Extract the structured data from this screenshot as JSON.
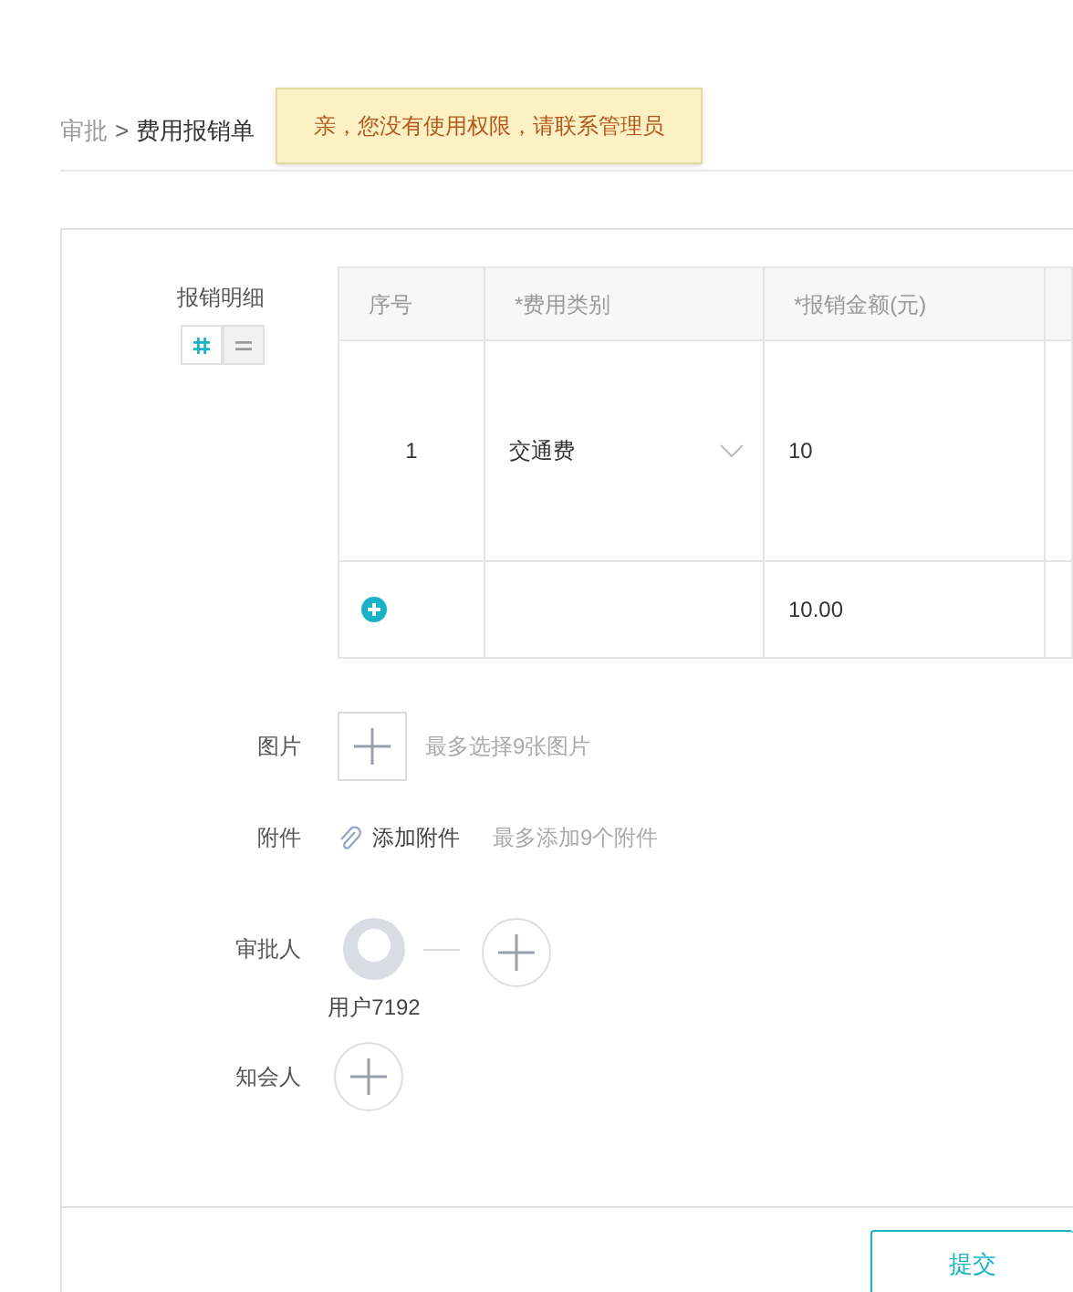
{
  "breadcrumb": {
    "parent": "审批",
    "separator": ">",
    "current": "费用报销单"
  },
  "toast": "亲，您没有使用权限，请联系管理员",
  "detail": {
    "label": "报销明细",
    "view_toggle": [
      {
        "kind": "grid",
        "selected": true
      },
      {
        "kind": "list",
        "selected": false
      }
    ],
    "columns": [
      {
        "title": "序号"
      },
      {
        "title": "*费用类别"
      },
      {
        "title": "*报销金额(元)"
      }
    ],
    "rows": [
      {
        "index": "1",
        "category": "交通费",
        "amount": "10"
      }
    ],
    "total": "10.00"
  },
  "images": {
    "label": "图片",
    "hint": "最多选择9张图片"
  },
  "attachments": {
    "label": "附件",
    "action": "添加附件",
    "hint": "最多添加9个附件"
  },
  "approvers": {
    "label": "审批人",
    "people": [
      {
        "name": "用户7192"
      }
    ]
  },
  "cc": {
    "label": "知会人"
  },
  "submit": "提交"
}
